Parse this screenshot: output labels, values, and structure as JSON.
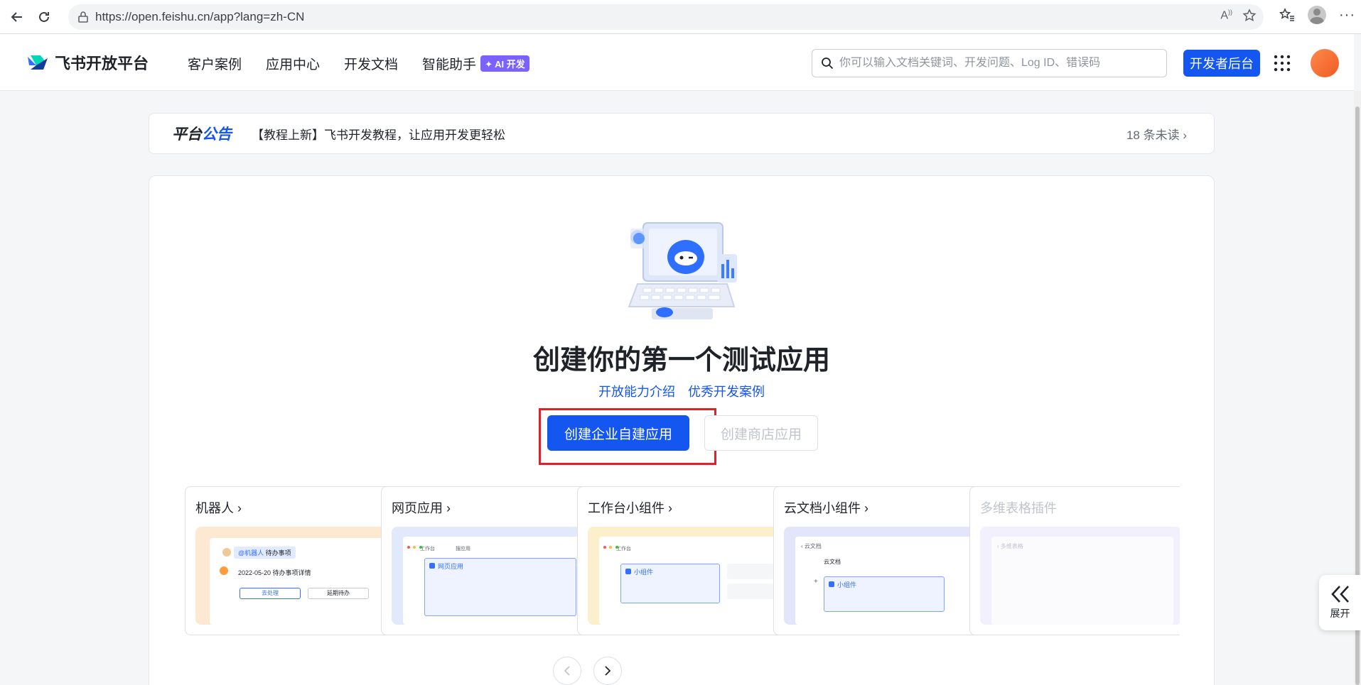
{
  "browser": {
    "url": "https://open.feishu.cn/app?lang=zh-CN"
  },
  "header": {
    "logo_text": "飞书开放平台",
    "nav": [
      "客户案例",
      "应用中心",
      "开发文档",
      "智能助手"
    ],
    "ai_badge": "✦ AI 开发",
    "search_placeholder": "你可以输入文档关键词、开发问题、Log ID、错误码",
    "dev_console_label": "开发者后台"
  },
  "announcement": {
    "tag_part1": "平台",
    "tag_part2": "公告",
    "message": "【教程上新】飞书开发教程，让应用开发更轻松",
    "unread": "18 条未读"
  },
  "main": {
    "headline": "创建你的第一个测试应用",
    "link_intro": "开放能力介绍",
    "link_cases": "优秀开发案例",
    "create_internal_label": "创建企业自建应用",
    "create_store_label": "创建商店应用"
  },
  "app_types": [
    {
      "title": "机器人",
      "preview": {
        "bot_tag": "@机器人",
        "bot_task": "待办事项",
        "date_line": "2022-05-20 待办事项详情",
        "btn1": "去处理",
        "btn2": "延期待办"
      }
    },
    {
      "title": "网页应用",
      "preview": {
        "tab1": "工作台",
        "tab2": "搜应用",
        "item": "网页应用"
      }
    },
    {
      "title": "工作台小组件",
      "preview": {
        "tab1": "工作台",
        "item": "小组件"
      }
    },
    {
      "title": "云文档小组件",
      "preview": {
        "back": "云文档",
        "doc": "云文档",
        "item": "小组件"
      }
    },
    {
      "title": "多维表格插件",
      "preview": {
        "item": "多维表格"
      }
    }
  ],
  "side_expand_label": "展开",
  "colors": {
    "primary": "#1456f0",
    "highlight": "#e0202a",
    "ai_badge": "#7b61ff"
  }
}
